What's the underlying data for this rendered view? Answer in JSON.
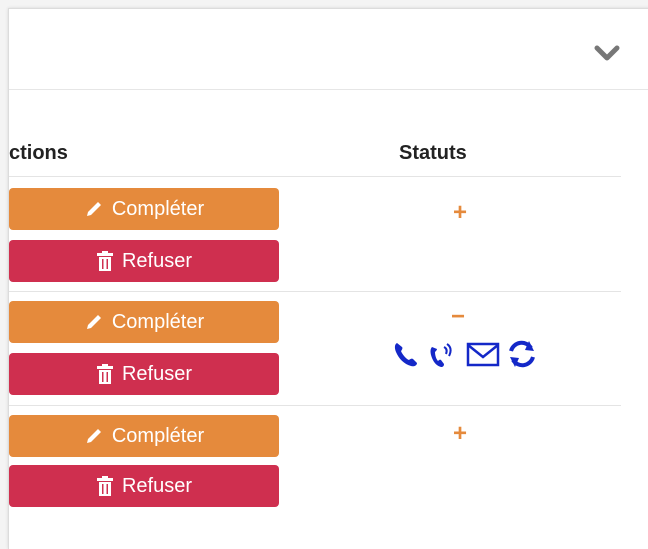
{
  "table": {
    "headers": {
      "actions": "ctions",
      "statuts": "Statuts"
    },
    "rows": [
      {
        "complete_label": "Compléter",
        "refuse_label": "Refuser",
        "status": "+"
      },
      {
        "complete_label": "Compléter",
        "refuse_label": "Refuser",
        "status": "−",
        "status_icons": [
          "phone-icon",
          "phone-ringing-icon",
          "envelope-icon",
          "refresh-icon"
        ]
      },
      {
        "complete_label": "Compléter",
        "refuse_label": "Refuser",
        "status": "+"
      }
    ]
  },
  "colors": {
    "complete_button": "#e58a3c",
    "refuse_button": "#cf2f4f",
    "status_icons": "#1428c8",
    "status_symbol": "#e58a3c"
  }
}
